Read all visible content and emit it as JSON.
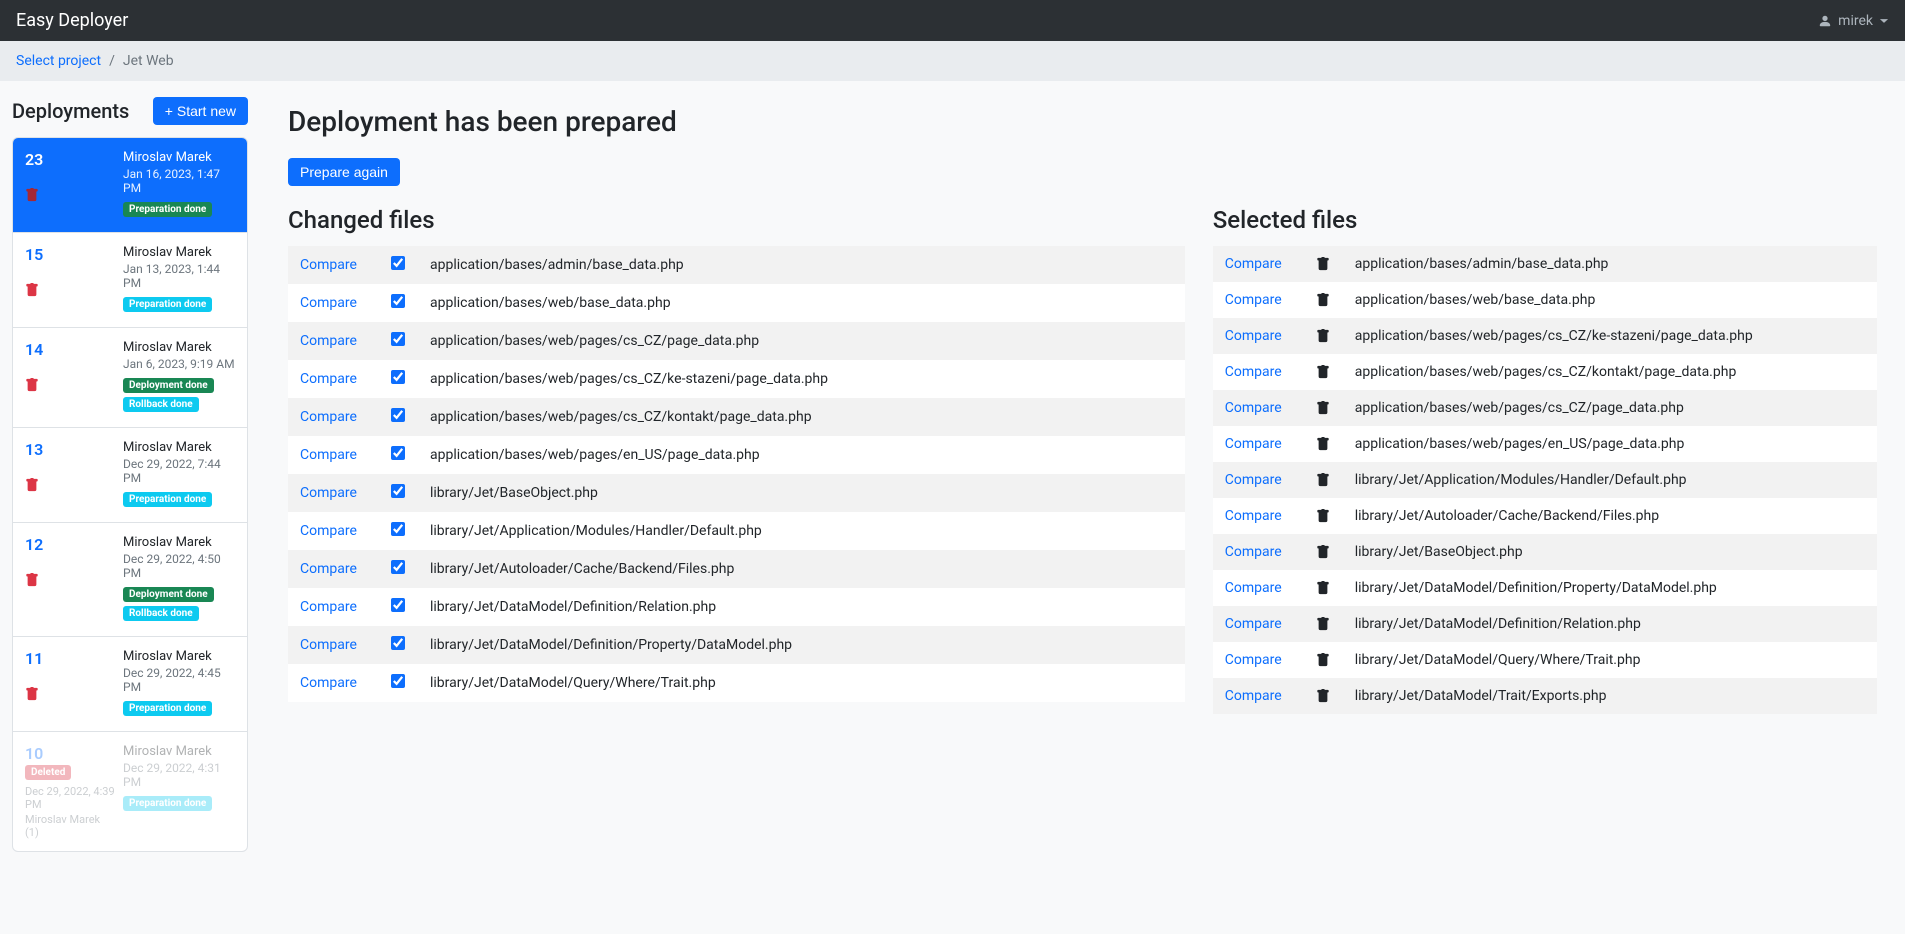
{
  "navbar": {
    "brand": "Easy Deployer",
    "user": "mirek"
  },
  "breadcrumb": {
    "link": "Select project",
    "current": "Jet Web"
  },
  "sidebar": {
    "title": "Deployments",
    "start_new": "Start new",
    "items": [
      {
        "num": "23",
        "user": "Miroslav Marek",
        "date": "Jan 16, 2023, 1:47 PM",
        "badges": [
          {
            "text": "Preparation done",
            "cls": "badge-success"
          }
        ],
        "active": true
      },
      {
        "num": "15",
        "user": "Miroslav Marek",
        "date": "Jan 13, 2023, 1:44 PM",
        "badges": [
          {
            "text": "Preparation done",
            "cls": "badge-info"
          }
        ]
      },
      {
        "num": "14",
        "user": "Miroslav Marek",
        "date": "Jan 6, 2023, 9:19 AM",
        "badges": [
          {
            "text": "Deployment done",
            "cls": "badge-success"
          },
          {
            "text": "Rollback done",
            "cls": "badge-info"
          }
        ]
      },
      {
        "num": "13",
        "user": "Miroslav Marek",
        "date": "Dec 29, 2022, 7:44 PM",
        "badges": [
          {
            "text": "Preparation done",
            "cls": "badge-info"
          }
        ]
      },
      {
        "num": "12",
        "user": "Miroslav Marek",
        "date": "Dec 29, 2022, 4:50 PM",
        "badges": [
          {
            "text": "Deployment done",
            "cls": "badge-success"
          },
          {
            "text": "Rollback done",
            "cls": "badge-info"
          }
        ]
      },
      {
        "num": "11",
        "user": "Miroslav Marek",
        "date": "Dec 29, 2022, 4:45 PM",
        "badges": [
          {
            "text": "Preparation done",
            "cls": "badge-info"
          }
        ]
      },
      {
        "num": "10",
        "user": "Miroslav Marek",
        "date": "Dec 29, 2022, 4:31 PM",
        "badges": [
          {
            "text": "Preparation done",
            "cls": "badge-info"
          }
        ],
        "faded": true,
        "leftDate": "Dec 29, 2022, 4:39 PM",
        "leftSub": "Miroslav Marek (1)",
        "deletedBadge": "Deleted"
      }
    ]
  },
  "main": {
    "title": "Deployment has been prepared",
    "prepare_again": "Prepare again",
    "compare_label": "Compare",
    "changed_title": "Changed files",
    "changed_files": [
      "application/bases/admin/base_data.php",
      "application/bases/web/base_data.php",
      "application/bases/web/pages/cs_CZ/page_data.php",
      "application/bases/web/pages/cs_CZ/ke-stazeni/page_data.php",
      "application/bases/web/pages/cs_CZ/kontakt/page_data.php",
      "application/bases/web/pages/en_US/page_data.php",
      "library/Jet/BaseObject.php",
      "library/Jet/Application/Modules/Handler/Default.php",
      "library/Jet/Autoloader/Cache/Backend/Files.php",
      "library/Jet/DataModel/Definition/Relation.php",
      "library/Jet/DataModel/Definition/Property/DataModel.php",
      "library/Jet/DataModel/Query/Where/Trait.php"
    ],
    "selected_title": "Selected files",
    "selected_files": [
      "application/bases/admin/base_data.php",
      "application/bases/web/base_data.php",
      "application/bases/web/pages/cs_CZ/ke-stazeni/page_data.php",
      "application/bases/web/pages/cs_CZ/kontakt/page_data.php",
      "application/bases/web/pages/cs_CZ/page_data.php",
      "application/bases/web/pages/en_US/page_data.php",
      "library/Jet/Application/Modules/Handler/Default.php",
      "library/Jet/Autoloader/Cache/Backend/Files.php",
      "library/Jet/BaseObject.php",
      "library/Jet/DataModel/Definition/Property/DataModel.php",
      "library/Jet/DataModel/Definition/Relation.php",
      "library/Jet/DataModel/Query/Where/Trait.php",
      "library/Jet/DataModel/Trait/Exports.php"
    ]
  }
}
